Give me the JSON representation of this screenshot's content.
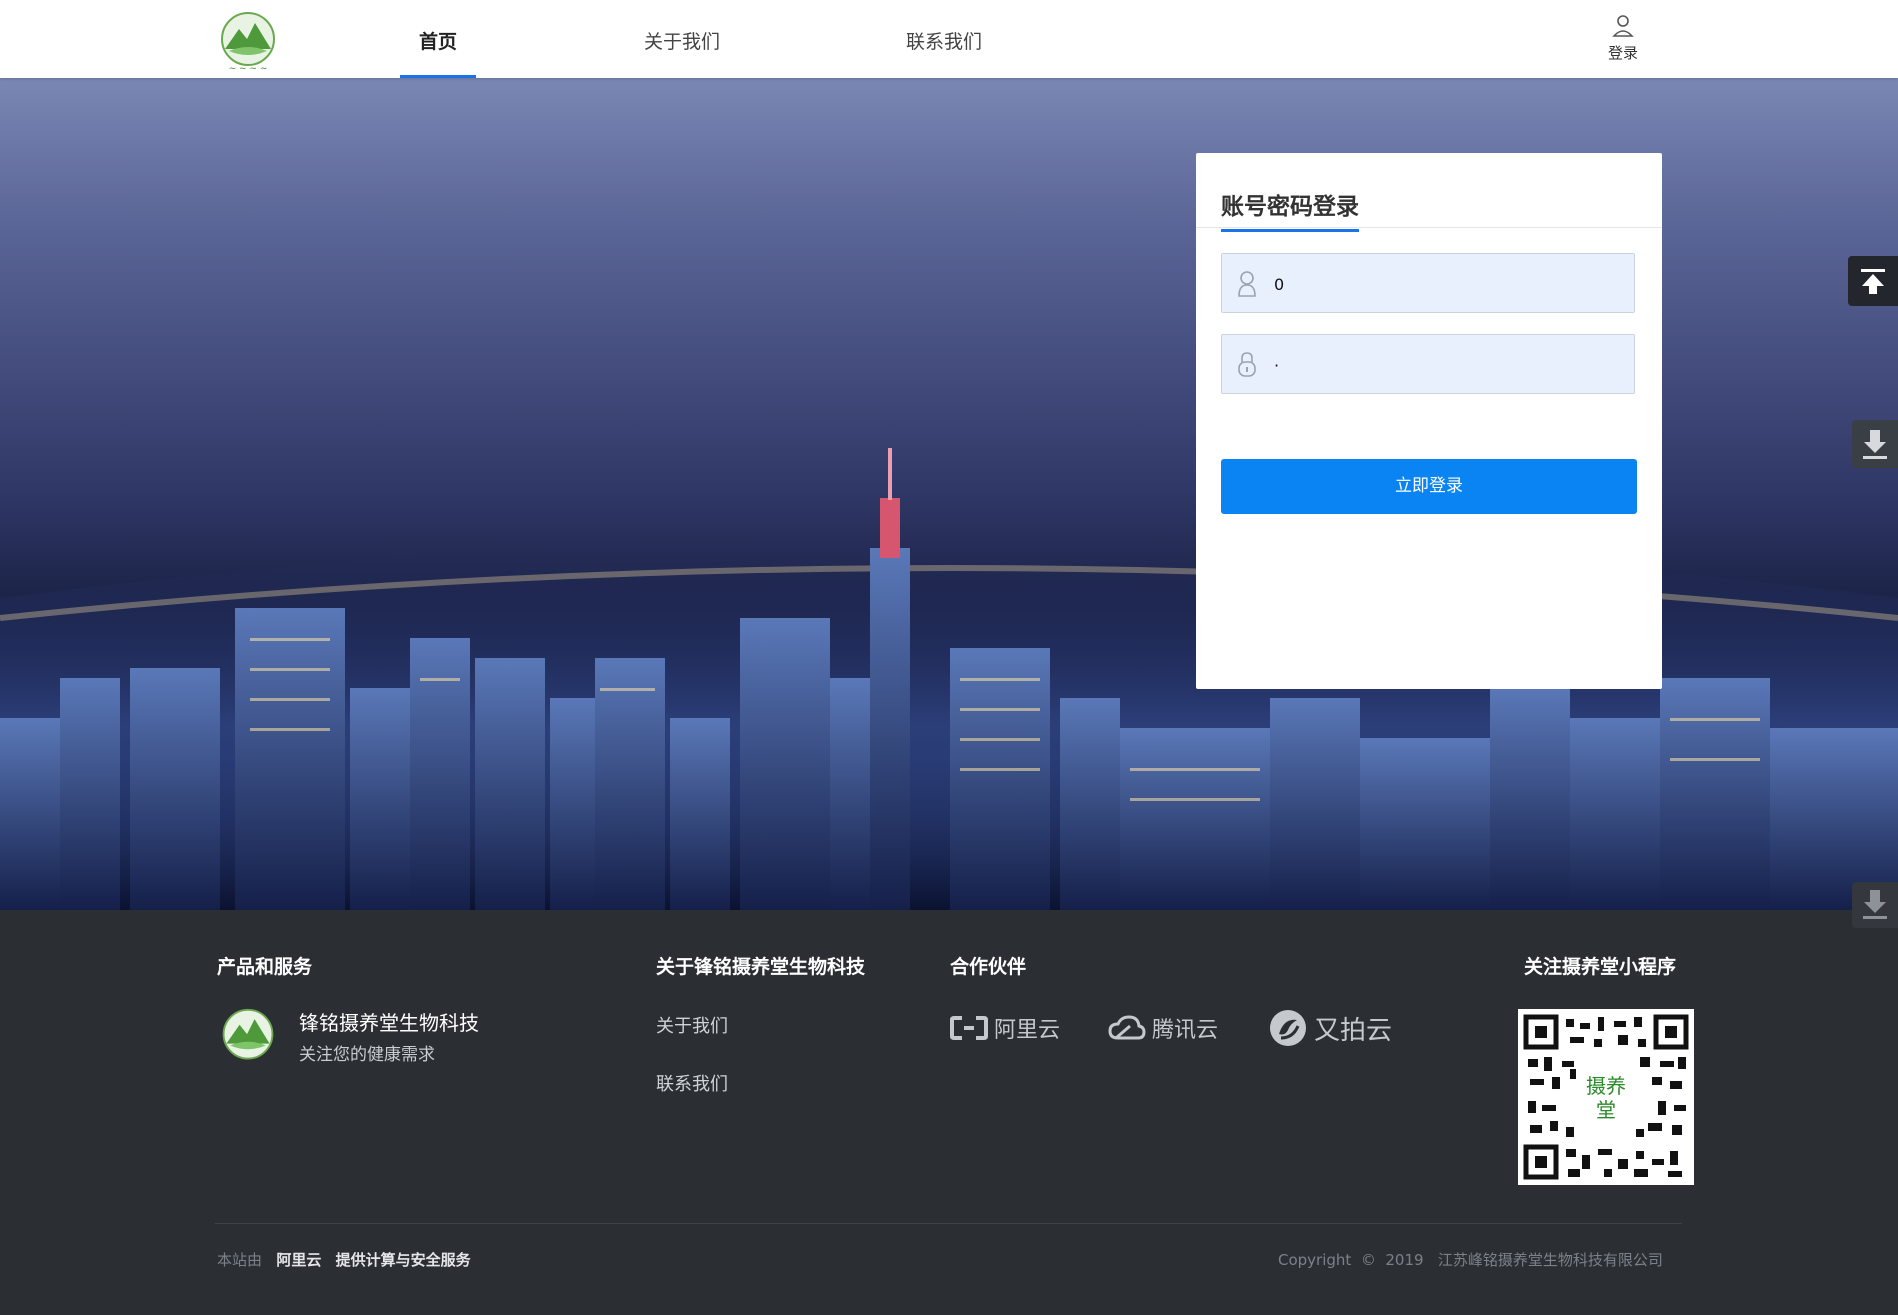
{
  "header": {
    "nav": [
      {
        "label": "首页",
        "active": true
      },
      {
        "label": "关于我们",
        "active": false
      },
      {
        "label": "联系我们",
        "active": false
      }
    ],
    "login_label": "登录"
  },
  "login_card": {
    "title": "账号密码登录",
    "username_value": "0",
    "password_value": "·",
    "submit_label": "立即登录"
  },
  "side_buttons": [
    "back-to-top-icon",
    "download-icon",
    "download-icon"
  ],
  "footer": {
    "col1": {
      "heading": "产品和服务",
      "brand_name": "锋铭摄养堂生物科技",
      "brand_slogan": "关注您的健康需求"
    },
    "col2": {
      "heading": "关于锋铭摄养堂生物科技",
      "links": [
        "关于我们",
        "联系我们"
      ]
    },
    "col3": {
      "heading": "合作伙伴",
      "partners": [
        "阿里云",
        "腾讯云",
        "又拍云"
      ]
    },
    "col4": {
      "heading": "关注摄养堂小程序"
    },
    "bottom": {
      "prefix": "本站由",
      "provider": "阿里云",
      "service": "提供计算与安全服务",
      "copyright": "Copyright  ©  2019   江苏峰铭摄养堂生物科技有限公司"
    }
  },
  "colors": {
    "accent": "#1a73e8",
    "button": "#0a84f2",
    "footer_bg": "#2b2f33"
  }
}
